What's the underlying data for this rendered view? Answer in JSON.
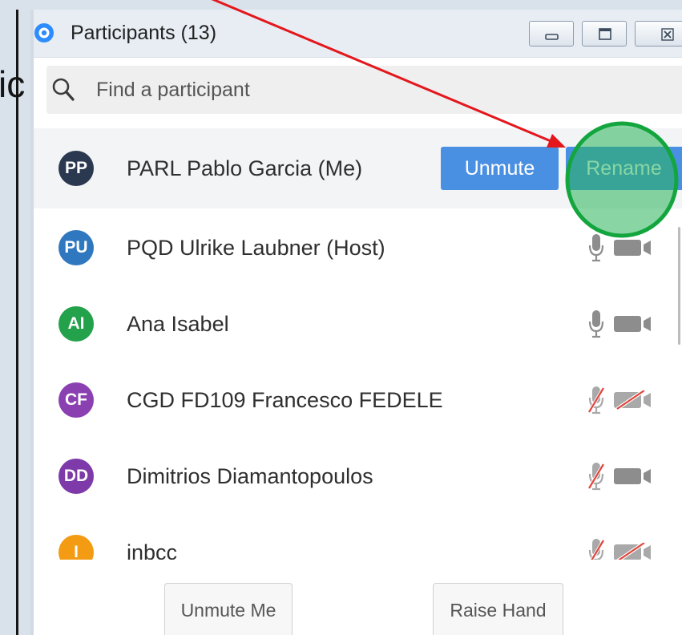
{
  "background_fragment": "ic",
  "window": {
    "title": "Participants (13)",
    "title_icon": "zoom-logo-icon",
    "controls": [
      "minimize-icon",
      "maximize-icon",
      "close-icon"
    ]
  },
  "search": {
    "icon": "search-icon",
    "placeholder": "Find a participant"
  },
  "participants": [
    {
      "initials": "PP",
      "name": "PARL Pablo Garcia (Me)",
      "avatar_color": "#2a3950",
      "unmute_button": "Unmute",
      "rename_button": "Rename"
    },
    {
      "initials": "PU",
      "name": "PQD Ulrike Laubner (Host)",
      "avatar_color": "#2f78bf",
      "mic_icon": "mic-icon",
      "video_icon": "video-icon"
    },
    {
      "initials": "AI",
      "name": "Ana Isabel",
      "avatar_color": "#24a14b",
      "mic_icon": "mic-icon",
      "video_icon": "video-icon"
    },
    {
      "initials": "CF",
      "name": "CGD FD109 Francesco FEDELE",
      "avatar_color": "#8b40b2",
      "mic_icon": "mic-muted-icon",
      "video_icon": "video-off-icon"
    },
    {
      "initials": "DD",
      "name": "Dimitrios Diamantopoulos",
      "avatar_color": "#7e3aa8",
      "mic_icon": "mic-muted-icon",
      "video_icon": "video-icon"
    },
    {
      "initials": "I",
      "name": "inbcc",
      "avatar_color": "#f39b13",
      "mic_icon": "mic-muted-icon",
      "video_icon": "video-off-icon"
    }
  ],
  "footer": {
    "unmute_me": "Unmute Me",
    "raise_hand": "Raise Hand"
  },
  "colors": {
    "button_blue": "#4a90e2",
    "annotation_arrow": "#e3171c",
    "annotation_circle": "#13a53e",
    "annotation_circle_fill": "rgba(40,180,90,0.55)"
  }
}
